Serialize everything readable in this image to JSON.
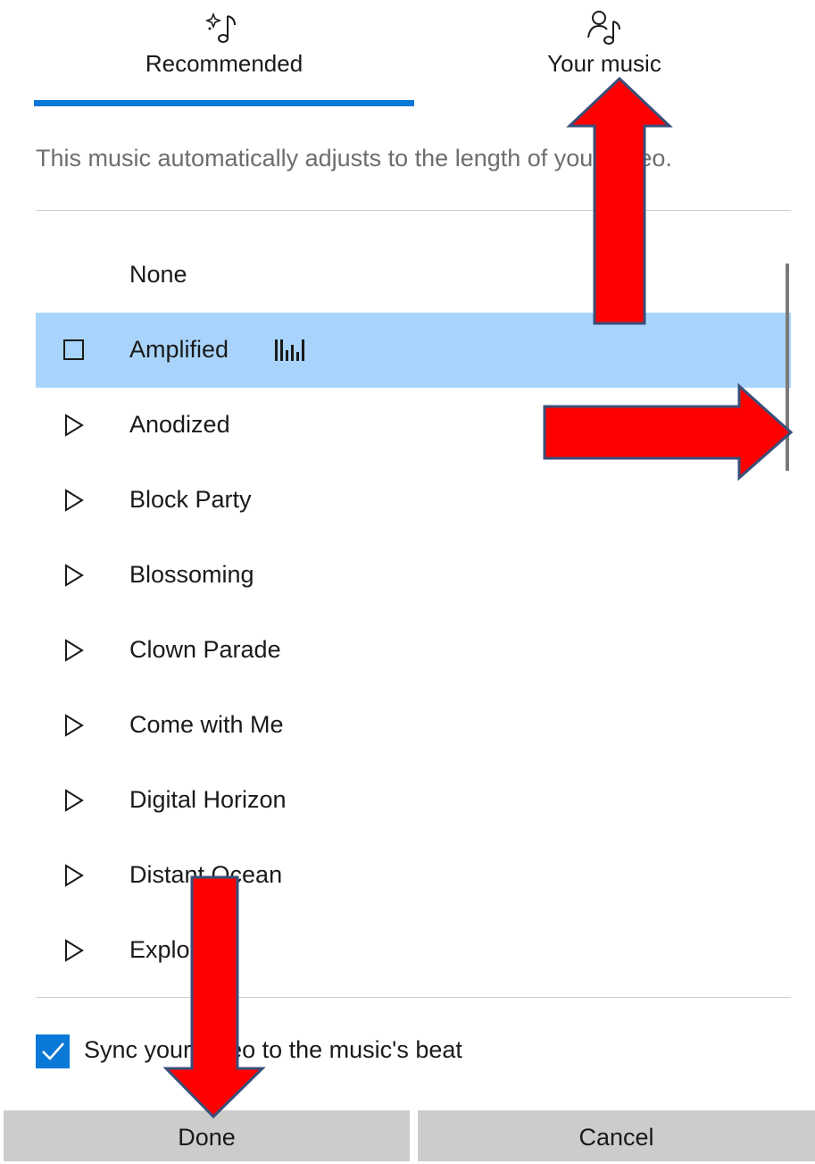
{
  "tabs": {
    "recommended": {
      "label": "Recommended",
      "icon": "sparkle-music-icon"
    },
    "your_music": {
      "label": "Your music",
      "icon": "person-music-icon"
    }
  },
  "description": "This music automatically adjusts to the length of your video.",
  "tracks": [
    {
      "label": "None",
      "icon": ""
    },
    {
      "label": "Amplified",
      "icon": "stop-icon",
      "selected": true,
      "playing": true
    },
    {
      "label": "Anodized",
      "icon": "play-icon"
    },
    {
      "label": "Block Party",
      "icon": "play-icon"
    },
    {
      "label": "Blossoming",
      "icon": "play-icon"
    },
    {
      "label": "Clown Parade",
      "icon": "play-icon"
    },
    {
      "label": "Come with Me",
      "icon": "play-icon"
    },
    {
      "label": "Digital Horizon",
      "icon": "play-icon"
    },
    {
      "label": "Distant Ocean",
      "icon": "play-icon"
    },
    {
      "label": "Explorer",
      "icon": "play-icon"
    }
  ],
  "sync": {
    "label": "Sync your video to the music's beat",
    "checked": true
  },
  "buttons": {
    "done": "Done",
    "cancel": "Cancel"
  },
  "colors": {
    "accent": "#0a78d7",
    "selected_row": "#a8d4fb",
    "annotation_arrow": "#ff0000"
  }
}
